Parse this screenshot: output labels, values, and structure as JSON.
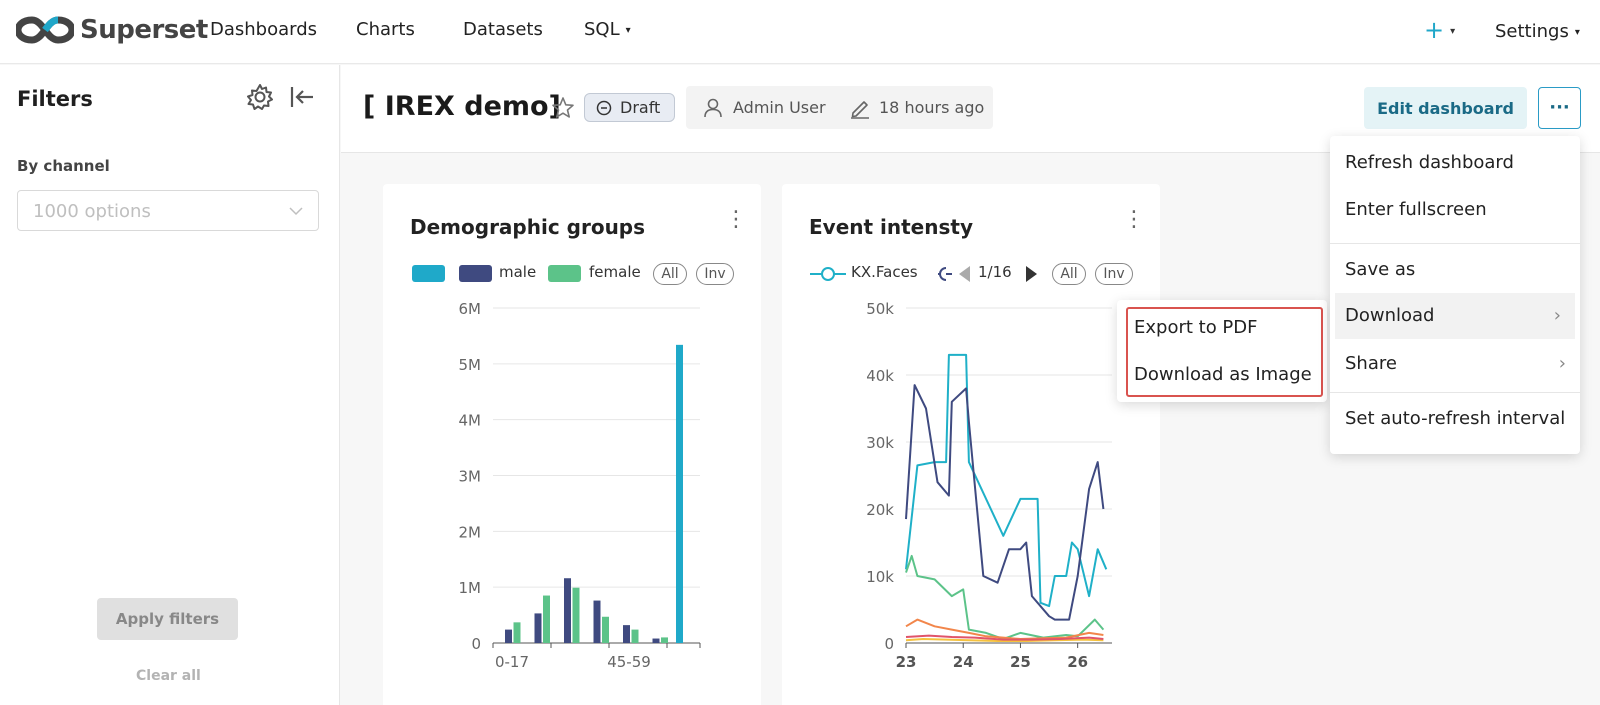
{
  "app": {
    "name": "Superset"
  },
  "nav": {
    "items": [
      "Dashboards",
      "Charts",
      "Datasets",
      "SQL"
    ],
    "settings": "Settings"
  },
  "colors": {
    "brand_teal": "#20a7c9",
    "brand_gray": "#444444",
    "male": "#3f4a80",
    "female": "#5cc389",
    "primary": "#1a6a86",
    "highlight": "#d9534f"
  },
  "filters": {
    "title": "Filters",
    "field_label": "By channel",
    "placeholder": "1000 options",
    "apply": "Apply filters",
    "clear": "Clear all"
  },
  "dashboard": {
    "title": "[ IREX demo]",
    "status": "Draft",
    "owner": "Admin User",
    "modified": "18 hours ago",
    "edit": "Edit dashboard",
    "more": "···"
  },
  "menu": {
    "refresh": "Refresh dashboard",
    "fullscreen": "Enter fullscreen",
    "save_as": "Save as",
    "download": "Download",
    "share": "Share",
    "auto_refresh": "Set auto-refresh interval"
  },
  "submenu": {
    "export_pdf": "Export to PDF",
    "download_image": "Download as Image"
  },
  "legend_controls": {
    "all": "All",
    "inv": "Inv",
    "page": "1/16"
  },
  "chart_data": [
    {
      "type": "bar",
      "title": "Demographic groups",
      "legend": [
        "",
        "male",
        "female"
      ],
      "yticks": [
        "0",
        "1M",
        "2M",
        "3M",
        "4M",
        "5M",
        "6M"
      ],
      "ylim": [
        0,
        6000000
      ],
      "xticks": [
        "0-17",
        "45-59"
      ],
      "bars": [
        {
          "x": 0,
          "male": 240000,
          "female": 370000
        },
        {
          "x": 1,
          "male": 530000,
          "female": 850000
        },
        {
          "x": 2,
          "male": 1160000,
          "female": 990000
        },
        {
          "x": 3,
          "male": 760000,
          "female": 470000
        },
        {
          "x": 4,
          "male": 320000,
          "female": 240000
        },
        {
          "x": 5,
          "male": 80000,
          "female": 100000
        }
      ],
      "unknown_value": 5340000
    },
    {
      "type": "line",
      "title": "Event intensty",
      "legend": [
        "KX.Faces"
      ],
      "yticks": [
        "0",
        "10k",
        "20k",
        "30k",
        "40k",
        "50k"
      ],
      "ylim": [
        0,
        50000
      ],
      "xticks": [
        "23",
        "24",
        "25",
        "26"
      ],
      "xlim": [
        23,
        26.6
      ],
      "series": [
        {
          "color": "#1fb0c8",
          "points": [
            [
              23.0,
              11000
            ],
            [
              23.2,
              26500
            ],
            [
              23.5,
              27000
            ],
            [
              23.7,
              27000
            ],
            [
              23.75,
              43000
            ],
            [
              24.05,
              43000
            ],
            [
              24.1,
              27000
            ],
            [
              24.7,
              16000
            ],
            [
              25.0,
              21500
            ],
            [
              25.3,
              21500
            ],
            [
              25.35,
              6000
            ],
            [
              25.5,
              5500
            ],
            [
              25.6,
              10000
            ],
            [
              25.8,
              10000
            ],
            [
              25.9,
              15000
            ],
            [
              26.0,
              14000
            ],
            [
              26.2,
              7000
            ],
            [
              26.35,
              14000
            ],
            [
              26.5,
              11000
            ]
          ]
        },
        {
          "color": "#3f4a80",
          "points": [
            [
              23.0,
              18500
            ],
            [
              23.15,
              38500
            ],
            [
              23.35,
              35000
            ],
            [
              23.55,
              24000
            ],
            [
              23.75,
              22000
            ],
            [
              23.8,
              36000
            ],
            [
              24.05,
              38000
            ],
            [
              24.1,
              33000
            ],
            [
              24.35,
              10000
            ],
            [
              24.6,
              9000
            ],
            [
              24.8,
              14000
            ],
            [
              25.0,
              14000
            ],
            [
              25.1,
              15000
            ],
            [
              25.2,
              7000
            ],
            [
              25.5,
              4000
            ],
            [
              25.6,
              3500
            ],
            [
              25.85,
              3500
            ],
            [
              26.0,
              10000
            ],
            [
              26.2,
              23000
            ],
            [
              26.35,
              27000
            ],
            [
              26.45,
              20000
            ]
          ]
        },
        {
          "color": "#5cc389",
          "points": [
            [
              23.0,
              10500
            ],
            [
              23.1,
              13000
            ],
            [
              23.2,
              10000
            ],
            [
              23.5,
              9500
            ],
            [
              23.8,
              7000
            ],
            [
              24.0,
              8000
            ],
            [
              24.1,
              2000
            ],
            [
              24.4,
              1500
            ],
            [
              24.7,
              600
            ],
            [
              25.0,
              1500
            ],
            [
              25.4,
              800
            ],
            [
              25.8,
              1200
            ],
            [
              26.0,
              1000
            ],
            [
              26.3,
              3500
            ],
            [
              26.45,
              2000
            ]
          ]
        },
        {
          "color": "#f2864b",
          "points": [
            [
              23.0,
              2500
            ],
            [
              23.2,
              3500
            ],
            [
              23.5,
              2500
            ],
            [
              23.8,
              2000
            ],
            [
              24.1,
              1500
            ],
            [
              24.4,
              1000
            ],
            [
              24.7,
              800
            ],
            [
              25.0,
              600
            ],
            [
              25.4,
              700
            ],
            [
              25.8,
              800
            ],
            [
              26.2,
              1500
            ],
            [
              26.45,
              1200
            ]
          ]
        },
        {
          "color": "#f5c23e",
          "points": [
            [
              23.0,
              400
            ],
            [
              23.3,
              600
            ],
            [
              23.7,
              500
            ],
            [
              24.1,
              400
            ],
            [
              24.6,
              300
            ],
            [
              25.1,
              300
            ],
            [
              25.6,
              400
            ],
            [
              26.1,
              500
            ],
            [
              26.45,
              400
            ]
          ]
        },
        {
          "color": "#e0546a",
          "points": [
            [
              23.0,
              900
            ],
            [
              23.4,
              1100
            ],
            [
              23.8,
              900
            ],
            [
              24.2,
              800
            ],
            [
              24.7,
              500
            ],
            [
              25.2,
              500
            ],
            [
              25.7,
              600
            ],
            [
              26.2,
              800
            ],
            [
              26.45,
              600
            ]
          ]
        }
      ]
    }
  ]
}
